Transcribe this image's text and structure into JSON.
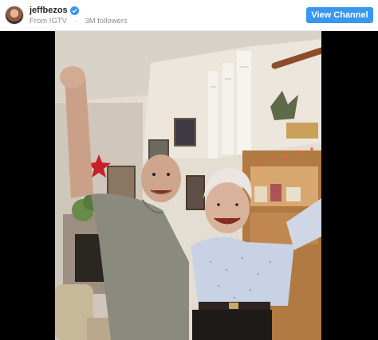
{
  "post_header": {
    "username": "jeffbezos",
    "verified_icon": "verified-badge-icon",
    "source": "From IGTV",
    "separator": "·",
    "followers": "3M followers",
    "view_channel_label": "View Channel",
    "accent_color": "#3897f0"
  },
  "video": {
    "background_color": "#000000"
  }
}
